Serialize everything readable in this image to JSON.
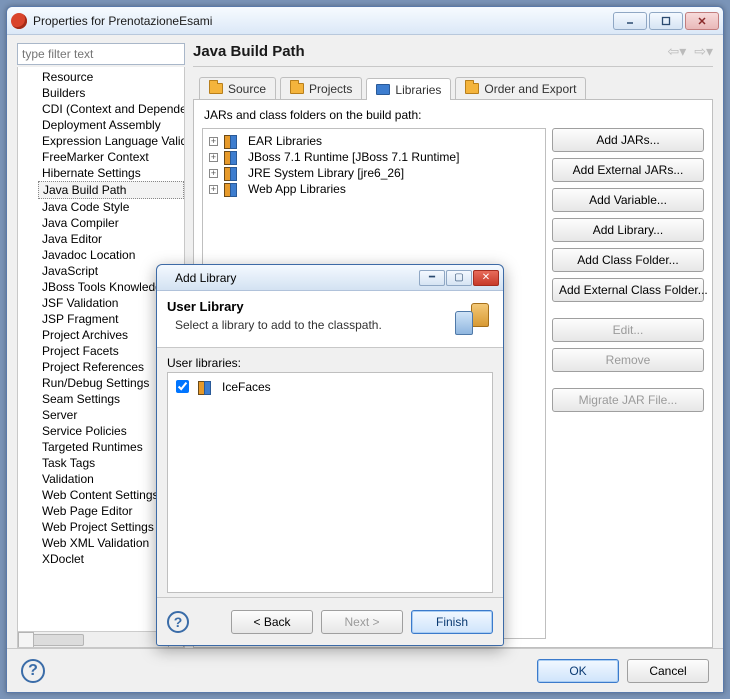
{
  "window": {
    "title": "Properties for PrenotazioneEsami"
  },
  "filter": {
    "placeholder": "type filter text"
  },
  "tree": {
    "items": [
      "Resource",
      "Builders",
      "CDI (Context and Dependen",
      "Deployment Assembly",
      "Expression Language Valida",
      "FreeMarker Context",
      "Hibernate Settings",
      "Java Build Path",
      "Java Code Style",
      "Java Compiler",
      "Java Editor",
      "Javadoc Location",
      "JavaScript",
      "JBoss Tools Knowledge",
      "JSF Validation",
      "JSP Fragment",
      "Project Archives",
      "Project Facets",
      "Project References",
      "Run/Debug Settings",
      "Seam Settings",
      "Server",
      "Service Policies",
      "Targeted Runtimes",
      "Task Tags",
      "Validation",
      "Web Content Settings",
      "Web Page Editor",
      "Web Project Settings",
      "Web XML Validation",
      "XDoclet"
    ],
    "selected_index": 7
  },
  "heading": "Java Build Path",
  "tabs": {
    "items": [
      "Source",
      "Projects",
      "Libraries",
      "Order and Export"
    ],
    "active_index": 2
  },
  "buildpath": {
    "desc": "JARs and class folders on the build path:",
    "entries": [
      "EAR Libraries",
      "JBoss 7.1 Runtime [JBoss 7.1 Runtime]",
      "JRE System Library [jre6_26]",
      "Web App Libraries"
    ]
  },
  "side_buttons": {
    "add_jars": "Add JARs...",
    "add_ext_jars": "Add External JARs...",
    "add_variable": "Add Variable...",
    "add_library": "Add Library...",
    "add_class_folder": "Add Class Folder...",
    "add_ext_class_folder": "Add External Class Folder...",
    "edit": "Edit...",
    "remove": "Remove",
    "migrate": "Migrate JAR File..."
  },
  "footer": {
    "ok": "OK",
    "cancel": "Cancel"
  },
  "modal": {
    "title": "Add Library",
    "head_title": "User Library",
    "head_sub": "Select a library to add to the classpath.",
    "group_label": "User libraries:",
    "entries": [
      {
        "label": "IceFaces",
        "checked": true
      }
    ],
    "back": "< Back",
    "next": "Next >",
    "finish": "Finish"
  }
}
